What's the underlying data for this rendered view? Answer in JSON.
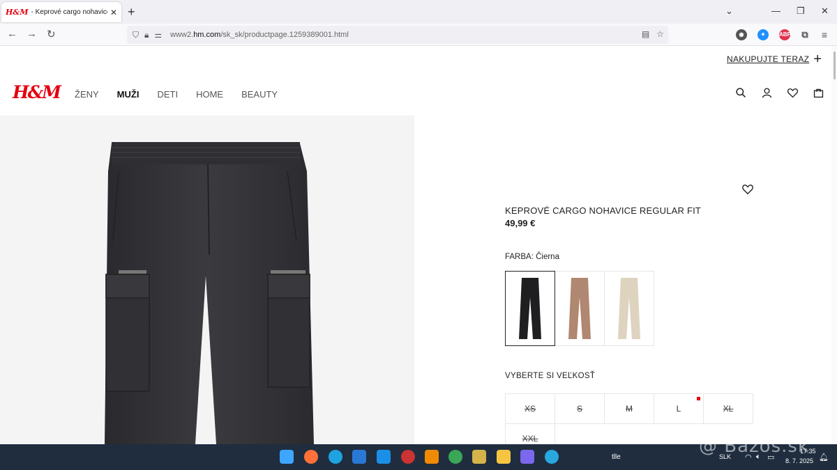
{
  "browser": {
    "tab_title": "- Keprové cargo nohavice Regul",
    "tab_favicon": "H&M",
    "url_domain": "www2.",
    "url_host": "hm.com",
    "url_path": "/sk_sk/productpage.1259389001.html",
    "new_tab": "+",
    "close": "✕"
  },
  "header": {
    "promo_label": "NAKUPUJTE TERAZ",
    "logo": "H&M",
    "nav": [
      "ŽENY",
      "MUŽI",
      "DETI",
      "HOME",
      "BEAUTY"
    ]
  },
  "product": {
    "title": "KEPROVÉ CARGO NOHAVICE REGULAR FIT",
    "price": "49,99 €",
    "color_label": "FARBA: Čierna",
    "swatch_colors": [
      "#1f1f21",
      "#b08770",
      "#ddd3bf"
    ],
    "size_title": "VYBERTE SI VEĽKOSŤ",
    "sizes": [
      {
        "label": "XS",
        "available": false
      },
      {
        "label": "S",
        "available": false
      },
      {
        "label": "M",
        "available": false
      },
      {
        "label": "L",
        "available": true,
        "low_stock": true
      },
      {
        "label": "XL",
        "available": false
      },
      {
        "label": "XXL",
        "available": false
      }
    ]
  },
  "taskbar": {
    "time": "17:35",
    "date": "8. 7. 2025",
    "lang": "SLK",
    "tray_app": "tlle",
    "watermark": "@ Bazos.sk"
  },
  "colors": {
    "brand_red": "#e50010",
    "taskbar": "#1f2d3f"
  }
}
